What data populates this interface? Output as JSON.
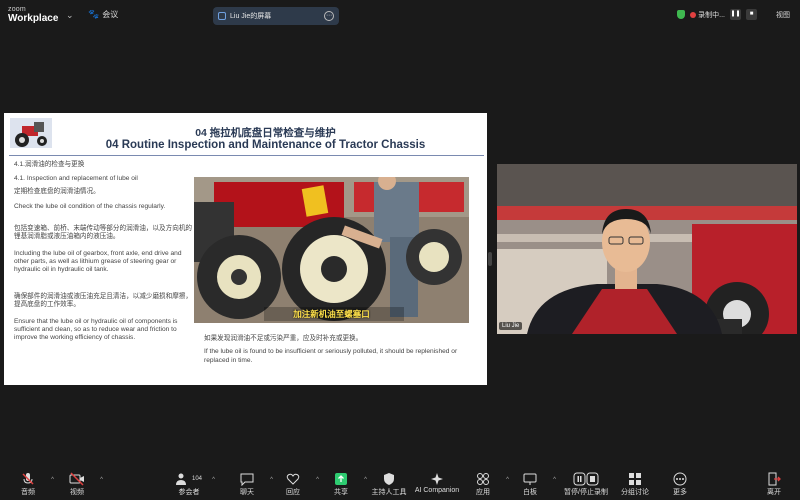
{
  "app": {
    "brand_line1": "zoom",
    "brand_line2": "Workplace",
    "meeting_label": "会议"
  },
  "share_pill": {
    "label": "Liu Jie的屏幕"
  },
  "status": {
    "recording": "录制中...",
    "view": "视图"
  },
  "slide": {
    "title_cn": "04 拖拉机底盘日常检查与维护",
    "title_en": "04 Routine Inspection and Maintenance of Tractor Chassis",
    "section": "4.1.润滑油的检查与更换",
    "p1": "4.1. Inspection and replacement of lube oil",
    "p2": "定期检查底盘的润滑油情况。",
    "p3": "Check the lube oil condition of the chassis regularly.",
    "p4": "包括变速箱、前桥、末端传动等部分的润滑油，以及方向机的锂基润滑脂或液压油箱内的液压油。",
    "p5": "Including the lube oil of gearbox, front axle, end drive and other parts, as well as lithium grease of steering gear or hydraulic oil in hydraulic oil tank.",
    "p6": "确保部件的润滑油或液压油充足且清洁，以减少磨损和摩擦，提高底盘的工作效率。",
    "p7": "Ensure that the lube oil or hydraulic oil of components is sufficient and clean, so as to reduce wear and friction to improve the working efficiency of chassis.",
    "photo_subtitle": "加注新机油至螺塞口",
    "cap1": "如果发现润滑油不足或污染严重，应及时补充或更换。",
    "cap2": "If the lube oil is found to be insufficient or seriously polluted, it should be replenished or replaced in time."
  },
  "video": {
    "name": "Liu Jie"
  },
  "toolbar": [
    {
      "label": "音频",
      "icon": "mic-muted-icon"
    },
    {
      "label": "视频",
      "icon": "video-off-icon"
    },
    {
      "label": "参会者",
      "icon": "participants-icon",
      "count": "104"
    },
    {
      "label": "聊天",
      "icon": "chat-icon"
    },
    {
      "label": "回应",
      "icon": "heart-icon"
    },
    {
      "label": "共享",
      "icon": "share-icon"
    },
    {
      "label": "主持人工具",
      "icon": "host-tools-icon"
    },
    {
      "label": "AI Companion",
      "icon": "ai-companion-icon"
    },
    {
      "label": "应用",
      "icon": "apps-icon"
    },
    {
      "label": "白板",
      "icon": "whiteboard-icon"
    },
    {
      "label": "暂停/停止录制",
      "icon": "record-icon"
    },
    {
      "label": "分组讨论",
      "icon": "breakout-icon"
    },
    {
      "label": "更多",
      "icon": "more-icon"
    },
    {
      "label": "离开",
      "icon": "leave-icon"
    }
  ],
  "colors": {
    "accent": "#3fb950",
    "leave": "#e04040",
    "share": "#2ecc71"
  }
}
